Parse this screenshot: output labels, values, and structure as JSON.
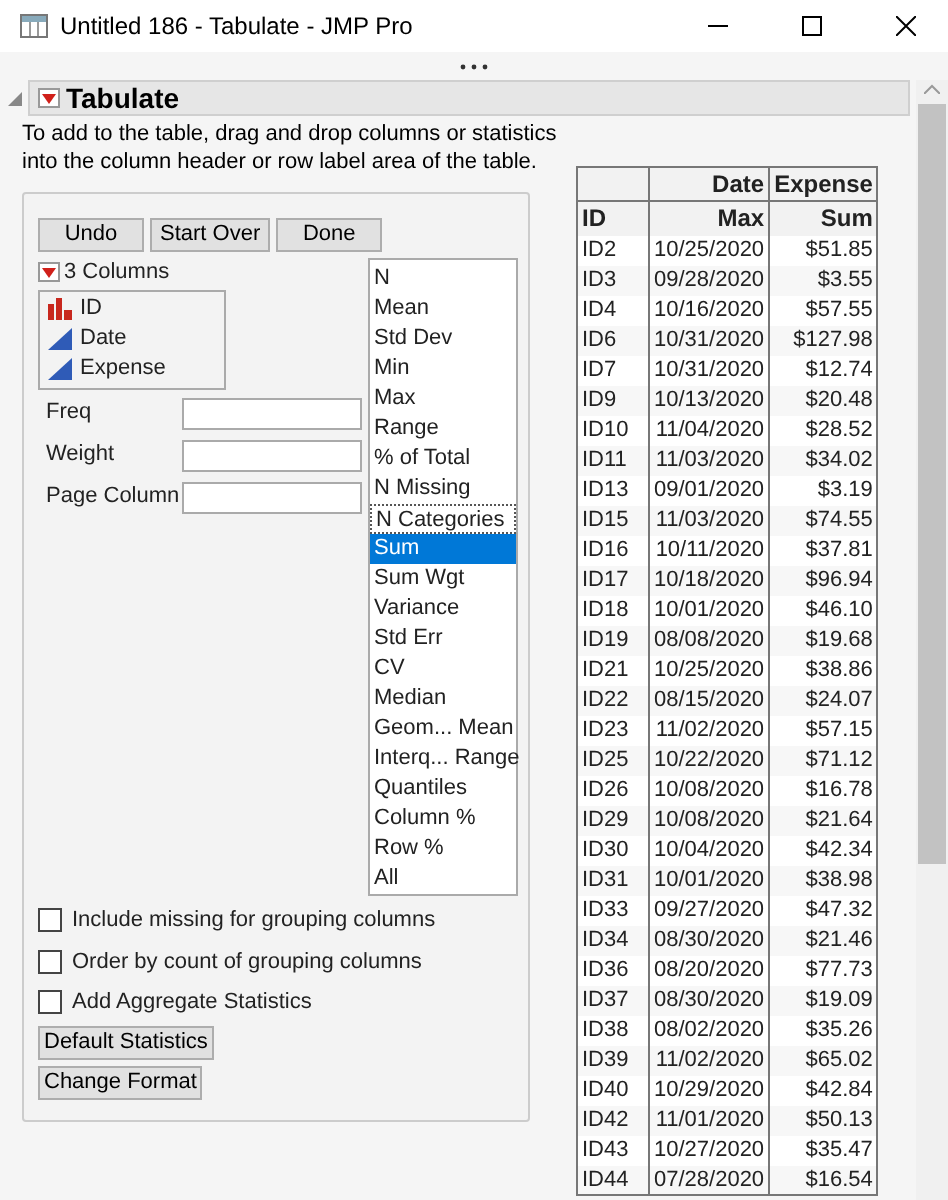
{
  "window": {
    "title": "Untitled 186 - Tabulate - JMP Pro"
  },
  "panel": {
    "title": "Tabulate",
    "instructions": "To add to the table, drag and drop columns or statistics into the column header or row label area of the table."
  },
  "buttons": [
    "Undo",
    "Start Over",
    "Done"
  ],
  "columns": {
    "label": "3 Columns",
    "items": [
      {
        "name": "ID",
        "kind": "nominal"
      },
      {
        "name": "Date",
        "kind": "continuous"
      },
      {
        "name": "Expense",
        "kind": "continuous"
      }
    ]
  },
  "roles": [
    {
      "label": "Freq"
    },
    {
      "label": "Weight"
    },
    {
      "label": "Page Column"
    }
  ],
  "statistics": [
    {
      "label": "N",
      "selected": false,
      "focused": false
    },
    {
      "label": "Mean",
      "selected": false,
      "focused": false
    },
    {
      "label": "Std Dev",
      "selected": false,
      "focused": false
    },
    {
      "label": "Min",
      "selected": false,
      "focused": false
    },
    {
      "label": "Max",
      "selected": false,
      "focused": false
    },
    {
      "label": "Range",
      "selected": false,
      "focused": false
    },
    {
      "label": "% of Total",
      "selected": false,
      "focused": false
    },
    {
      "label": "N Missing",
      "selected": false,
      "focused": false
    },
    {
      "label": "N Categories",
      "selected": false,
      "focused": true
    },
    {
      "label": "Sum",
      "selected": true,
      "focused": false
    },
    {
      "label": "Sum Wgt",
      "selected": false,
      "focused": false
    },
    {
      "label": "Variance",
      "selected": false,
      "focused": false
    },
    {
      "label": "Std Err",
      "selected": false,
      "focused": false
    },
    {
      "label": "CV",
      "selected": false,
      "focused": false
    },
    {
      "label": "Median",
      "selected": false,
      "focused": false
    },
    {
      "label": "Geom... Mean",
      "selected": false,
      "focused": false
    },
    {
      "label": "Interq... Range",
      "selected": false,
      "focused": false
    },
    {
      "label": "Quantiles",
      "selected": false,
      "focused": false
    },
    {
      "label": "Column %",
      "selected": false,
      "focused": false
    },
    {
      "label": "Row %",
      "selected": false,
      "focused": false
    },
    {
      "label": "All",
      "selected": false,
      "focused": false
    }
  ],
  "options": [
    {
      "label": "Include missing for grouping columns",
      "checked": false
    },
    {
      "label": "Order by count of grouping columns",
      "checked": false
    },
    {
      "label": "Add Aggregate Statistics",
      "checked": false
    }
  ],
  "action_buttons": [
    "Default Statistics",
    "Change Format"
  ],
  "table": {
    "header_top": [
      "Date",
      "Expense"
    ],
    "header_bottom": [
      "ID",
      "Max",
      "Sum"
    ],
    "rows": [
      [
        "ID2",
        "10/25/2020",
        "$51.85"
      ],
      [
        "ID3",
        "09/28/2020",
        "$3.55"
      ],
      [
        "ID4",
        "10/16/2020",
        "$57.55"
      ],
      [
        "ID6",
        "10/31/2020",
        "$127.98"
      ],
      [
        "ID7",
        "10/31/2020",
        "$12.74"
      ],
      [
        "ID9",
        "10/13/2020",
        "$20.48"
      ],
      [
        "ID10",
        "11/04/2020",
        "$28.52"
      ],
      [
        "ID11",
        "11/03/2020",
        "$34.02"
      ],
      [
        "ID13",
        "09/01/2020",
        "$3.19"
      ],
      [
        "ID15",
        "11/03/2020",
        "$74.55"
      ],
      [
        "ID16",
        "10/11/2020",
        "$37.81"
      ],
      [
        "ID17",
        "10/18/2020",
        "$96.94"
      ],
      [
        "ID18",
        "10/01/2020",
        "$46.10"
      ],
      [
        "ID19",
        "08/08/2020",
        "$19.68"
      ],
      [
        "ID21",
        "10/25/2020",
        "$38.86"
      ],
      [
        "ID22",
        "08/15/2020",
        "$24.07"
      ],
      [
        "ID23",
        "11/02/2020",
        "$57.15"
      ],
      [
        "ID25",
        "10/22/2020",
        "$71.12"
      ],
      [
        "ID26",
        "10/08/2020",
        "$16.78"
      ],
      [
        "ID29",
        "10/08/2020",
        "$21.64"
      ],
      [
        "ID30",
        "10/04/2020",
        "$42.34"
      ],
      [
        "ID31",
        "10/01/2020",
        "$38.98"
      ],
      [
        "ID33",
        "09/27/2020",
        "$47.32"
      ],
      [
        "ID34",
        "08/30/2020",
        "$21.46"
      ],
      [
        "ID36",
        "08/20/2020",
        "$77.73"
      ],
      [
        "ID37",
        "08/30/2020",
        "$19.09"
      ],
      [
        "ID38",
        "08/02/2020",
        "$35.26"
      ],
      [
        "ID39",
        "11/02/2020",
        "$65.02"
      ],
      [
        "ID40",
        "10/29/2020",
        "$42.84"
      ],
      [
        "ID42",
        "11/01/2020",
        "$50.13"
      ],
      [
        "ID43",
        "10/27/2020",
        "$35.47"
      ],
      [
        "ID44",
        "07/28/2020",
        "$16.54"
      ]
    ]
  }
}
